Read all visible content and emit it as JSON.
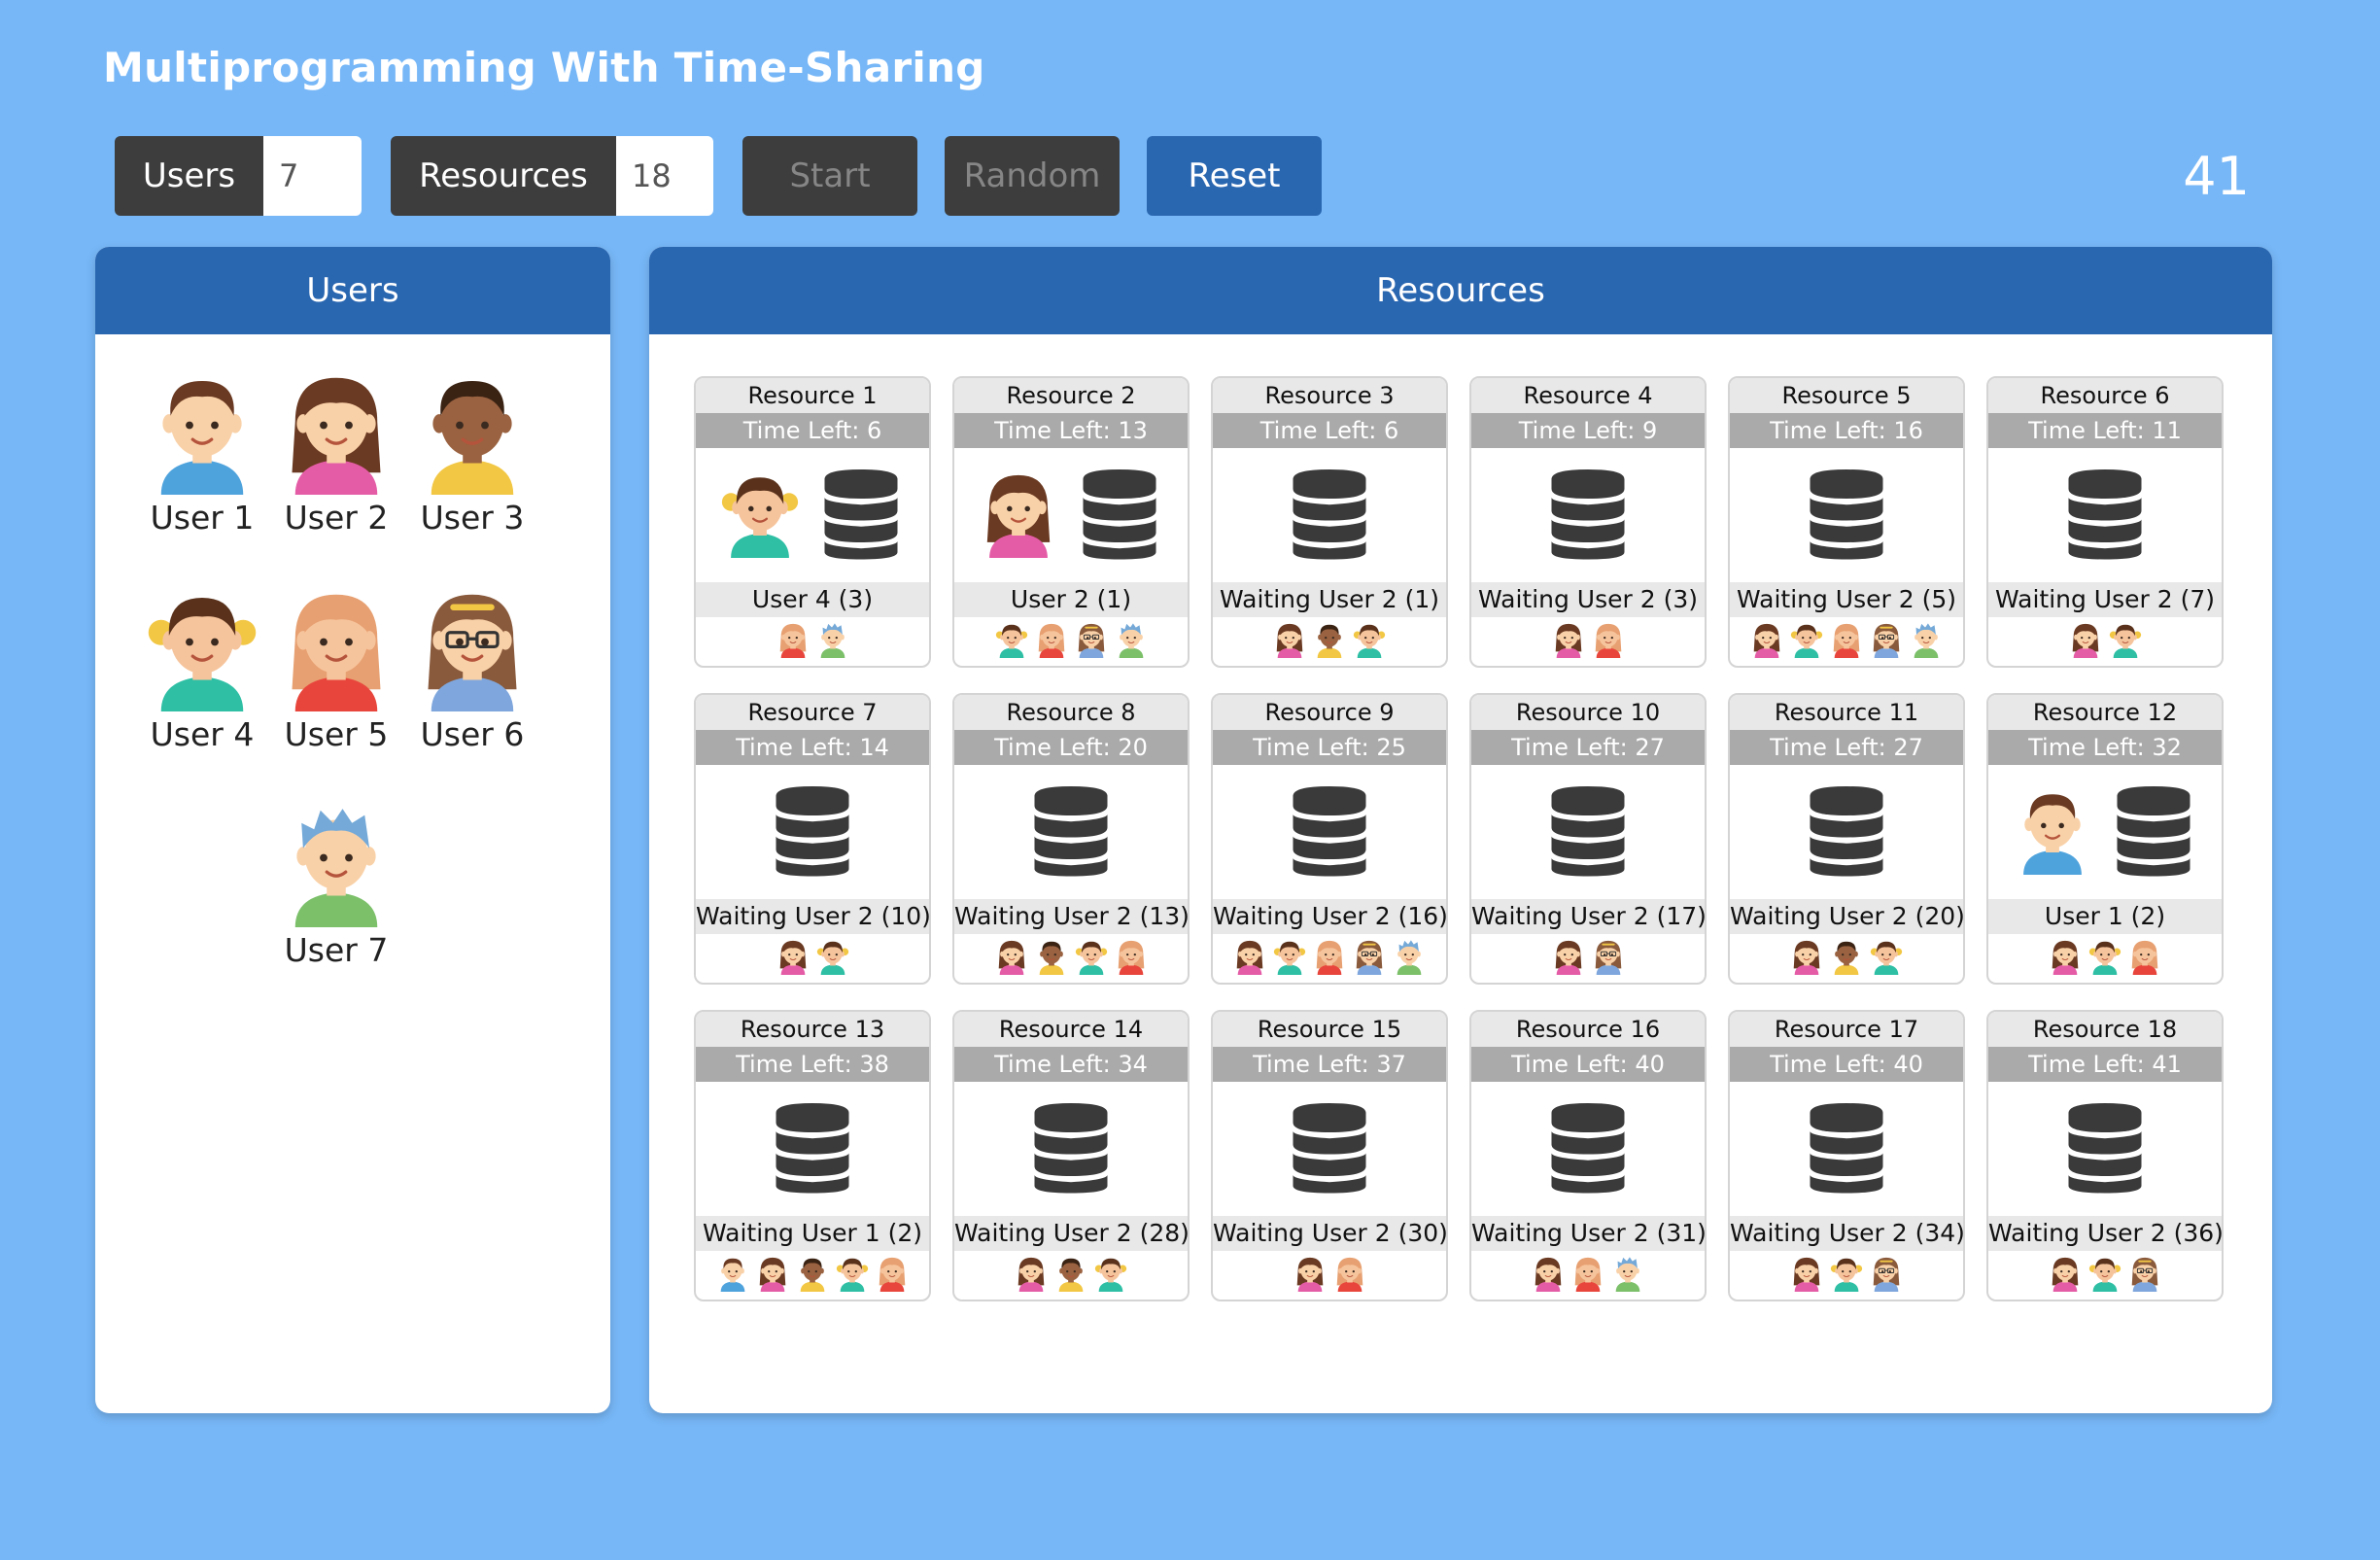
{
  "title": "Multiprogramming With Time-Sharing",
  "controls": {
    "users_label": "Users",
    "users_value": "7",
    "resources_label": "Resources",
    "resources_value": "18",
    "start_label": "Start",
    "random_label": "Random",
    "reset_label": "Reset",
    "clock": "41"
  },
  "users_panel": {
    "title": "Users",
    "users": [
      {
        "label": "User 1",
        "avatar": "boy-brown-hair-blue-shirt"
      },
      {
        "label": "User 2",
        "avatar": "girl-long-brown-hair-pink-shirt"
      },
      {
        "label": "User 3",
        "avatar": "boy-dark-skin-yellow-shirt"
      },
      {
        "label": "User 4",
        "avatar": "girl-pigtails-teal-shirt"
      },
      {
        "label": "User 5",
        "avatar": "girl-blonde-red-shirt"
      },
      {
        "label": "User 6",
        "avatar": "girl-glasses-blue-shirt"
      },
      {
        "label": "User 7",
        "avatar": "boy-blue-hair-green-shirt"
      }
    ]
  },
  "resources_panel": {
    "title": "Resources",
    "resources": [
      {
        "name": "Resource 1",
        "time": "Time Left: 6",
        "status": "User 4 (3)",
        "holder": 4,
        "queue": [
          5,
          7
        ]
      },
      {
        "name": "Resource 2",
        "time": "Time Left: 13",
        "status": "User 2 (1)",
        "holder": 2,
        "queue": [
          4,
          5,
          6,
          7
        ]
      },
      {
        "name": "Resource 3",
        "time": "Time Left: 6",
        "status": "Waiting User 2 (1)",
        "holder": 0,
        "queue": [
          2,
          3,
          4
        ]
      },
      {
        "name": "Resource 4",
        "time": "Time Left: 9",
        "status": "Waiting User 2 (3)",
        "holder": 0,
        "queue": [
          2,
          5
        ]
      },
      {
        "name": "Resource 5",
        "time": "Time Left: 16",
        "status": "Waiting User 2 (5)",
        "holder": 0,
        "queue": [
          2,
          4,
          5,
          6,
          7
        ]
      },
      {
        "name": "Resource 6",
        "time": "Time Left: 11",
        "status": "Waiting User 2 (7)",
        "holder": 0,
        "queue": [
          2,
          4
        ]
      },
      {
        "name": "Resource 7",
        "time": "Time Left: 14",
        "status": "Waiting User 2 (10)",
        "holder": 0,
        "queue": [
          2,
          4
        ]
      },
      {
        "name": "Resource 8",
        "time": "Time Left: 20",
        "status": "Waiting User 2 (13)",
        "holder": 0,
        "queue": [
          2,
          3,
          4,
          5
        ]
      },
      {
        "name": "Resource 9",
        "time": "Time Left: 25",
        "status": "Waiting User 2 (16)",
        "holder": 0,
        "queue": [
          2,
          4,
          5,
          6,
          7
        ]
      },
      {
        "name": "Resource 10",
        "time": "Time Left: 27",
        "status": "Waiting User 2 (17)",
        "holder": 0,
        "queue": [
          2,
          6
        ]
      },
      {
        "name": "Resource 11",
        "time": "Time Left: 27",
        "status": "Waiting User 2 (20)",
        "holder": 0,
        "queue": [
          2,
          3,
          4
        ]
      },
      {
        "name": "Resource 12",
        "time": "Time Left: 32",
        "status": "User 1 (2)",
        "holder": 1,
        "queue": [
          2,
          4,
          5
        ]
      },
      {
        "name": "Resource 13",
        "time": "Time Left: 38",
        "status": "Waiting User 1 (2)",
        "holder": 0,
        "queue": [
          1,
          2,
          3,
          4,
          5
        ]
      },
      {
        "name": "Resource 14",
        "time": "Time Left: 34",
        "status": "Waiting User 2 (28)",
        "holder": 0,
        "queue": [
          2,
          3,
          4
        ]
      },
      {
        "name": "Resource 15",
        "time": "Time Left: 37",
        "status": "Waiting User 2 (30)",
        "holder": 0,
        "queue": [
          2,
          5
        ]
      },
      {
        "name": "Resource 16",
        "time": "Time Left: 40",
        "status": "Waiting User 2 (31)",
        "holder": 0,
        "queue": [
          2,
          5,
          7
        ]
      },
      {
        "name": "Resource 17",
        "time": "Time Left: 40",
        "status": "Waiting User 2 (34)",
        "holder": 0,
        "queue": [
          2,
          4,
          6
        ]
      },
      {
        "name": "Resource 18",
        "time": "Time Left: 41",
        "status": "Waiting User 2 (36)",
        "holder": 0,
        "queue": [
          2,
          4,
          6
        ]
      }
    ]
  },
  "colors": {
    "background": "#77b7f7",
    "header_blue": "#2a67b1",
    "button_dark": "#3d3d3d",
    "database": "#3a3a3a"
  }
}
